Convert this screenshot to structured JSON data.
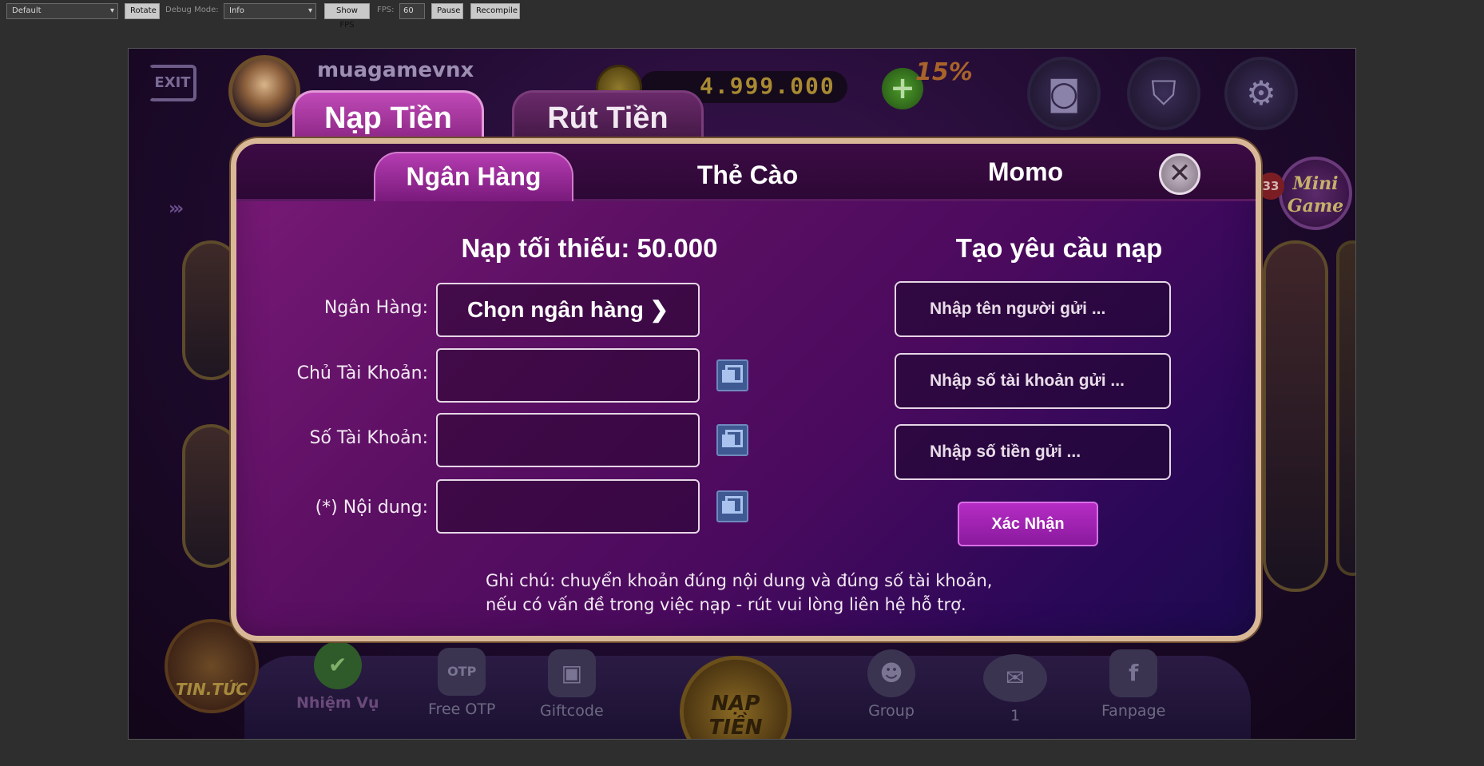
{
  "toolbar": {
    "device_select": "Default",
    "rotate": "Rotate",
    "debug_mode_label": "Debug Mode:",
    "debug_mode_value": "Info",
    "show_fps": "Show FPS",
    "fps_label": "FPS:",
    "fps_value": "60",
    "pause": "Pause",
    "recompile": "Recompile"
  },
  "hud": {
    "exit_label": "EXIT",
    "username": "muagamevnx",
    "balance": "4.999.000",
    "plus": "+",
    "bonus": "15%",
    "mini_badge": "33",
    "mini_game_line1": "Mini",
    "mini_game_line2": "Game",
    "news_label": "TIN.TỨC",
    "bottom": {
      "mission": "Nhiệm Vụ",
      "otp": "Free OTP",
      "otp_icon_text": "OTP",
      "giftcode": "Giftcode",
      "naptien": "NẠP TIỀN",
      "group": "Group",
      "mail_count": "1",
      "fanpage": "Fanpage"
    }
  },
  "tabs": {
    "deposit": "Nạp Tiền",
    "withdraw": "Rút Tiền"
  },
  "subtabs": {
    "bank": "Ngân Hàng",
    "card": "Thẻ Cào",
    "momo": "Momo"
  },
  "form": {
    "min_title": "Nạp tối thiếu: 50.000",
    "bank_label": "Ngân Hàng:",
    "bank_select": "Chọn ngân hàng",
    "owner_label": "Chủ Tài Khoản:",
    "account_label": "Số Tài Khoản:",
    "content_label": "(*) Nội dung:"
  },
  "request": {
    "title": "Tạo yêu cầu nạp",
    "sender_placeholder": "Nhập tên người gửi ...",
    "account_placeholder": "Nhập số tài khoản gửi ...",
    "amount_placeholder": "Nhập số tiền gửi ...",
    "confirm": "Xác Nhận"
  },
  "note": {
    "line1": "Ghi chú: chuyển khoản đúng nội dung và đúng số tài khoản,",
    "line2": "nếu có vấn đề trong việc nạp - rút vui lòng liên hệ hỗ trợ."
  },
  "colors": {
    "panel_border": "#d9b898",
    "panel_purple": "#5a0f62",
    "confirm_button": "#a323b5",
    "copy_icon": "#3f5a92"
  }
}
